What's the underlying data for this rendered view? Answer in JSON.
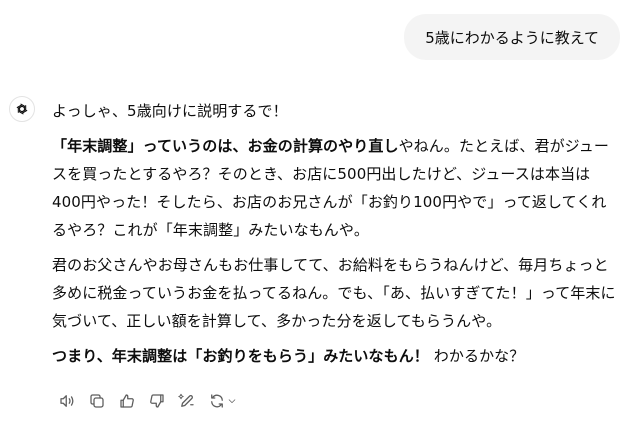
{
  "user_message": "5歳にわかるように教えて",
  "assistant": {
    "intro": "よっしゃ、5歳向けに説明するで！",
    "p1": {
      "b1": "「年末調整」っていうのは、お金の計算のやり直し",
      "t1": "やねん。たとえば、君がジュースを買ったとするやろ？そのとき、お店に500円出したけど、ジュースは本当は400円やった！そしたら、お店のお兄さんが「お釣り100円やで」って返してくれるやろ？これが「年末調整」みたいなもんや。"
    },
    "p2": "君のお父さんやお母さんもお仕事してて、お給料をもらうねんけど、毎月ちょっと多めに税金っていうお金を払ってるねん。でも、「あ、払いすぎてた！」って年末に気づいて、正しい額を計算して、多かった分を返してもらうんや。",
    "p3": {
      "b1": "つまり、年末調整は「お釣りをもらう」みたいなもん！",
      "t1": " わかるかな？"
    }
  },
  "actions": {
    "icons": [
      "read-aloud-icon",
      "copy-icon",
      "thumbs-up-icon",
      "thumbs-down-icon",
      "edit-icon",
      "regenerate-icon"
    ]
  }
}
